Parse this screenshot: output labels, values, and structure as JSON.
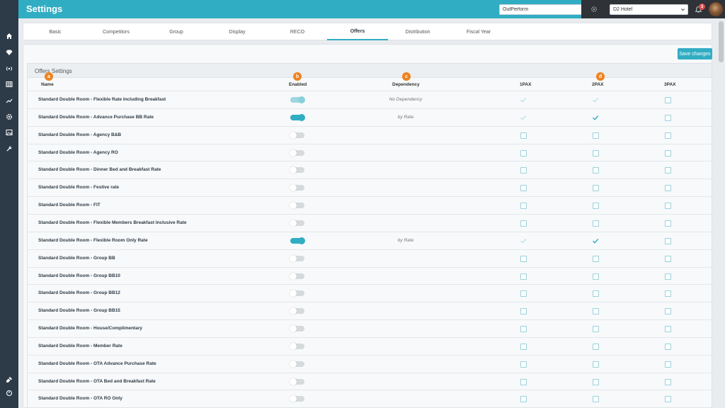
{
  "header": {
    "title": "Settings",
    "search_value": "OutPerform",
    "hotel": "D2 Hotel",
    "notification_count": "3"
  },
  "sidebar": {
    "icons": [
      "home-icon",
      "diamond-icon",
      "broadcast-icon",
      "grid-icon",
      "trend-chart-icon",
      "settings-icon",
      "image-icon",
      "wrench-icon",
      "plug-icon",
      "power-icon"
    ]
  },
  "tabs": [
    {
      "label": "Basic"
    },
    {
      "label": "Competitors"
    },
    {
      "label": "Group"
    },
    {
      "label": "Display"
    },
    {
      "label": "RECO"
    },
    {
      "label": "Offers"
    },
    {
      "label": "Distribution"
    },
    {
      "label": "Fiscal Year"
    }
  ],
  "active_tab": "Offers",
  "toolbar": {
    "save_label": "Save changes"
  },
  "section": {
    "title": "Offers Settings"
  },
  "markers": [
    "a",
    "b",
    "c",
    "d"
  ],
  "columns": {
    "name": "Name",
    "enabled": "Enabled",
    "dependency": "Dependency",
    "pax1": "1PAX",
    "pax2": "2PAX",
    "pax3": "3PAX"
  },
  "rows": [
    {
      "name": "Standard Double Room - Flexible Rate Including Breakfast",
      "enabled": "on-light",
      "dependency": "No Dependency",
      "pax": [
        "light",
        "light",
        "box"
      ]
    },
    {
      "name": "Standard Double Room - Advance Purchase BB Rate",
      "enabled": "on",
      "dependency": "by Rate",
      "pax": [
        "light",
        "dark",
        "box"
      ]
    },
    {
      "name": "Standard Double Room - Agency B&B",
      "enabled": "off",
      "dependency": "",
      "pax": [
        "box",
        "box",
        "box"
      ]
    },
    {
      "name": "Standard Double Room - Agency RO",
      "enabled": "off",
      "dependency": "",
      "pax": [
        "box",
        "box",
        "box"
      ]
    },
    {
      "name": "Standard Double Room - Dinner Bed and Breakfast Rate",
      "enabled": "off",
      "dependency": "",
      "pax": [
        "box",
        "box",
        "box"
      ]
    },
    {
      "name": "Standard Double Room - Festive rate",
      "enabled": "off",
      "dependency": "",
      "pax": [
        "box",
        "box",
        "box"
      ]
    },
    {
      "name": "Standard Double Room - FIT",
      "enabled": "off",
      "dependency": "",
      "pax": [
        "box",
        "box",
        "box"
      ]
    },
    {
      "name": "Standard Double Room - Flexible Members Breakfast Inclusive Rate",
      "enabled": "off",
      "dependency": "",
      "pax": [
        "box",
        "box",
        "box"
      ]
    },
    {
      "name": "Standard Double Room - Flexible Room Only Rate",
      "enabled": "on",
      "dependency": "by Rate",
      "pax": [
        "light",
        "dark",
        "box"
      ]
    },
    {
      "name": "Standard Double Room - Group BB",
      "enabled": "off",
      "dependency": "",
      "pax": [
        "box",
        "box",
        "box"
      ]
    },
    {
      "name": "Standard Double Room - Group BB10",
      "enabled": "off",
      "dependency": "",
      "pax": [
        "box",
        "box",
        "box"
      ]
    },
    {
      "name": "Standard Double Room - Group BB12",
      "enabled": "off",
      "dependency": "",
      "pax": [
        "box",
        "box",
        "box"
      ]
    },
    {
      "name": "Standard Double Room - Group BB15",
      "enabled": "off",
      "dependency": "",
      "pax": [
        "box",
        "box",
        "box"
      ]
    },
    {
      "name": "Standard Double Room - House/Complimentary",
      "enabled": "off",
      "dependency": "",
      "pax": [
        "box",
        "box",
        "box"
      ]
    },
    {
      "name": "Standard Double Room - Member Rate",
      "enabled": "off",
      "dependency": "",
      "pax": [
        "box",
        "box",
        "box"
      ]
    },
    {
      "name": "Standard Double Room - OTA Advance Purchase Rate",
      "enabled": "off",
      "dependency": "",
      "pax": [
        "box",
        "box",
        "box"
      ]
    },
    {
      "name": "Standard Double Room - OTA Bed and Breakfast Rate",
      "enabled": "off",
      "dependency": "",
      "pax": [
        "box",
        "box",
        "box"
      ]
    },
    {
      "name": "Standard Double Room - OTA RO Only",
      "enabled": "off",
      "dependency": "",
      "pax": [
        "box",
        "box",
        "box"
      ]
    }
  ],
  "colors": {
    "accent": "#31adc3",
    "sidebar": "#2d3a48",
    "marker": "#f0821e"
  }
}
